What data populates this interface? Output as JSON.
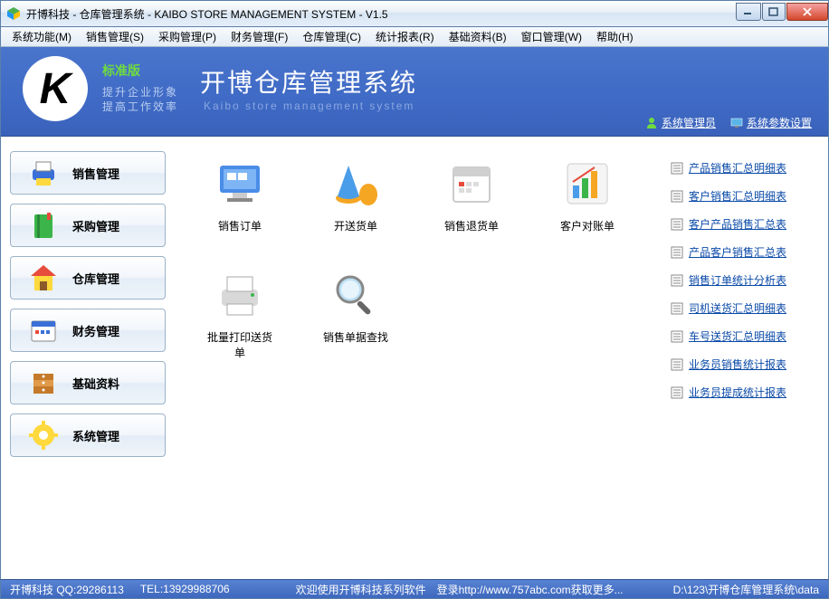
{
  "window": {
    "title": "开博科技 - 仓库管理系统 - KAIBO STORE MANAGEMENT SYSTEM - V1.5"
  },
  "menu": [
    "系统功能(M)",
    "销售管理(S)",
    "采购管理(P)",
    "财务管理(F)",
    "仓库管理(C)",
    "统计报表(R)",
    "基础资料(B)",
    "窗口管理(W)",
    "帮助(H)"
  ],
  "banner": {
    "edition": "标准版",
    "tagline1": "提升企业形象",
    "tagline2": "提高工作效率",
    "title": "开博仓库管理系统",
    "subtitle": "Kaibo store management system",
    "admin_link": "系统管理员",
    "settings_link": "系统参数设置"
  },
  "sidebar": [
    {
      "id": "sales",
      "label": "销售管理",
      "icon": "printer"
    },
    {
      "id": "purchase",
      "label": "采购管理",
      "icon": "book"
    },
    {
      "id": "warehouse",
      "label": "仓库管理",
      "icon": "house"
    },
    {
      "id": "finance",
      "label": "财务管理",
      "icon": "calendar"
    },
    {
      "id": "basedata",
      "label": "基础资料",
      "icon": "drawer"
    },
    {
      "id": "system",
      "label": "系统管理",
      "icon": "gear"
    }
  ],
  "center_icons": {
    "row1": [
      {
        "id": "sales-order",
        "label": "销售订单",
        "icon": "monitor"
      },
      {
        "id": "delivery",
        "label": "开送货单",
        "icon": "cone"
      },
      {
        "id": "return",
        "label": "销售退货单",
        "icon": "calendar-page"
      },
      {
        "id": "reconcile",
        "label": "客户对账单",
        "icon": "chart"
      }
    ],
    "row2": [
      {
        "id": "batch-print",
        "label": "批量打印送货单",
        "icon": "printer-big"
      },
      {
        "id": "search",
        "label": "销售单据查找",
        "icon": "magnifier"
      }
    ]
  },
  "reports": [
    "产品销售汇总明细表",
    "客户销售汇总明细表",
    "客户产品销售汇总表",
    "产品客户销售汇总表",
    "销售订单统计分析表",
    "司机送货汇总明细表",
    "车号送货汇总明细表",
    "业务员销售统计报表",
    "业务员提成统计报表"
  ],
  "status": {
    "left1": "开博科技 QQ:29286113",
    "left2": "TEL:13929988706",
    "center": "欢迎使用开博科技系列软件　登录http://www.757abc.com获取更多...",
    "right": "D:\\123\\开博仓库管理系统\\data"
  }
}
